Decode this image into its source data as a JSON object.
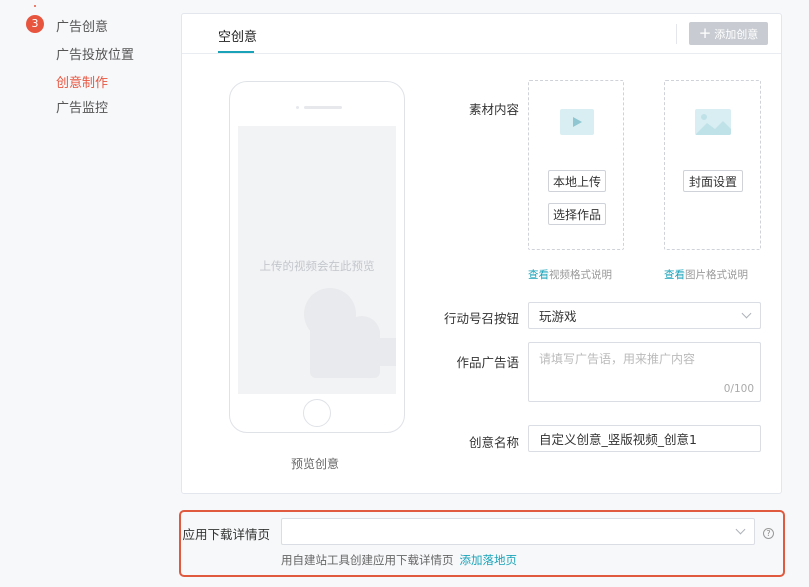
{
  "steps": {
    "badge": "3",
    "items": [
      {
        "label": "广告创意",
        "active": false
      },
      {
        "label": "广告投放位置",
        "active": false
      },
      {
        "label": "创意制作",
        "active": true
      },
      {
        "label": "广告监控",
        "active": false
      }
    ]
  },
  "card": {
    "tab_label": "空创意",
    "add_button": "添加创意",
    "phone": {
      "screen_text": "上传的视频会在此预览",
      "preview_label": "预览创意"
    },
    "material": {
      "label": "素材内容",
      "local_upload": "本地上传",
      "choose_work": "选择作品",
      "cover_setting": "封面设置",
      "video_link_prefix": "查看",
      "video_link_text": "视频格式说明",
      "image_link_prefix": "查看",
      "image_link_text": "图片格式说明"
    },
    "cta": {
      "label": "行动号召按钮",
      "value": "玩游戏"
    },
    "ad_text": {
      "label": "作品广告语",
      "placeholder": "请填写广告语，用来推广内容",
      "count": "0/100"
    },
    "creative_name": {
      "label": "创意名称",
      "value": "自定义创意_竖版视频_创意1"
    }
  },
  "download": {
    "label": "应用下载详情页",
    "value": "",
    "hint": "用自建站工具创建应用下载详情页",
    "hint_link": "添加落地页",
    "help_icon": "?"
  },
  "colors": {
    "accent": "#1aa3b8",
    "active_red": "#e8553f",
    "highlight_border": "#e05a3f"
  }
}
